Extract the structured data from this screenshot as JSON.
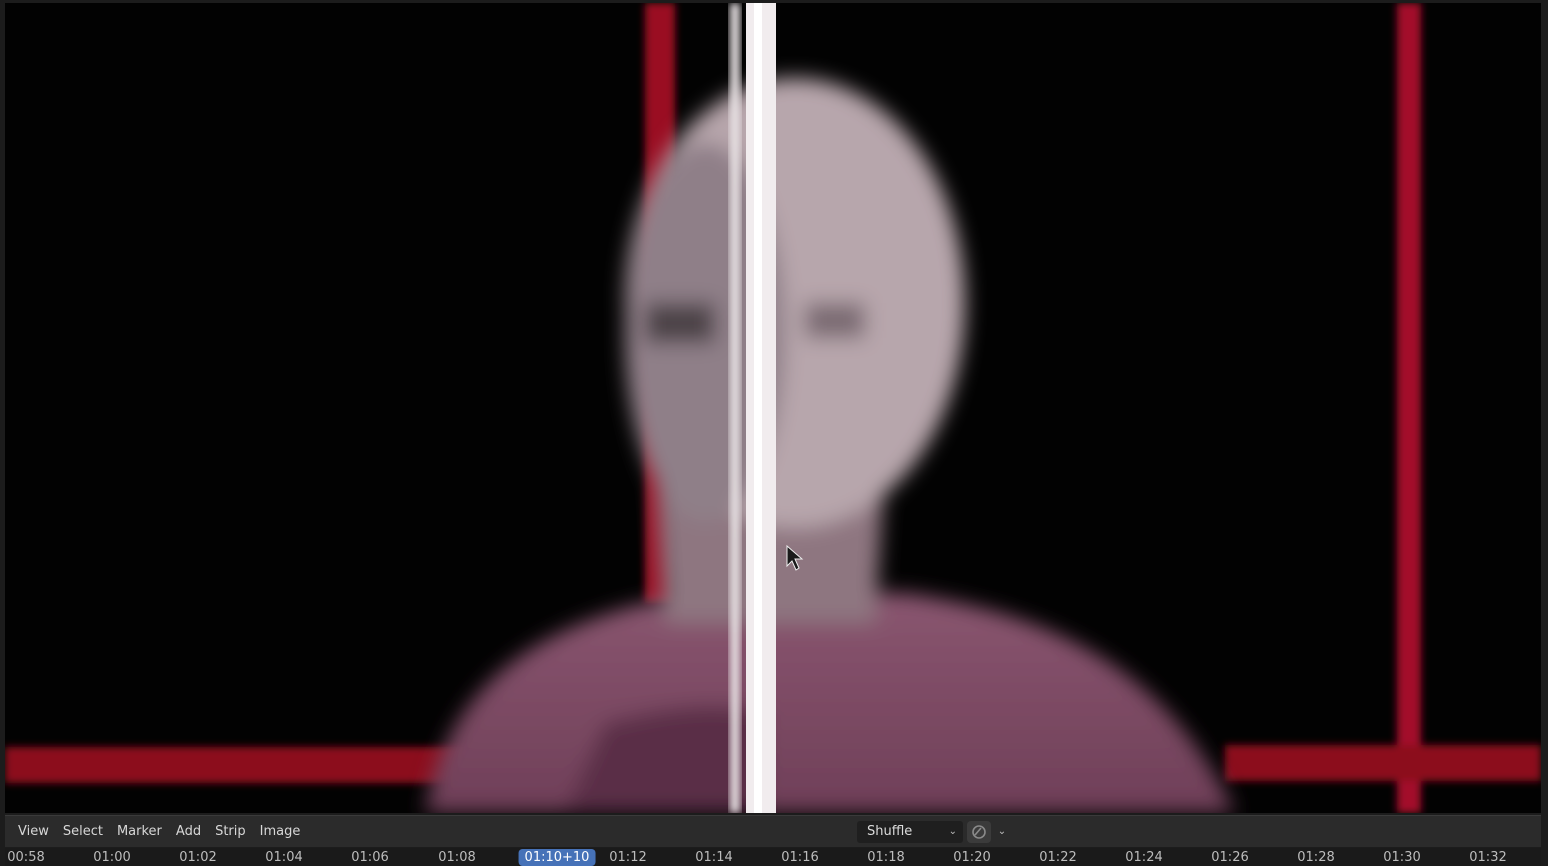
{
  "menu": {
    "items": [
      "View",
      "Select",
      "Marker",
      "Add",
      "Strip",
      "Image"
    ]
  },
  "header": {
    "blend_mode": "Shuffle"
  },
  "icons": {
    "overlay": "overlay-icon",
    "chevron": "chevron-down-icon"
  },
  "timeline": {
    "labels": [
      "00:58",
      "01:00",
      "01:02",
      "01:04",
      "01:06",
      "01:08",
      "01:10+10",
      "01:12",
      "01:14",
      "01:16",
      "01:18",
      "01:20",
      "01:22",
      "01:24",
      "01:26",
      "01:28",
      "01:30",
      "01:32"
    ],
    "current": "01:10+10"
  },
  "colors": {
    "current_frame": "#4672b8",
    "guide_red": "#c0152b"
  }
}
